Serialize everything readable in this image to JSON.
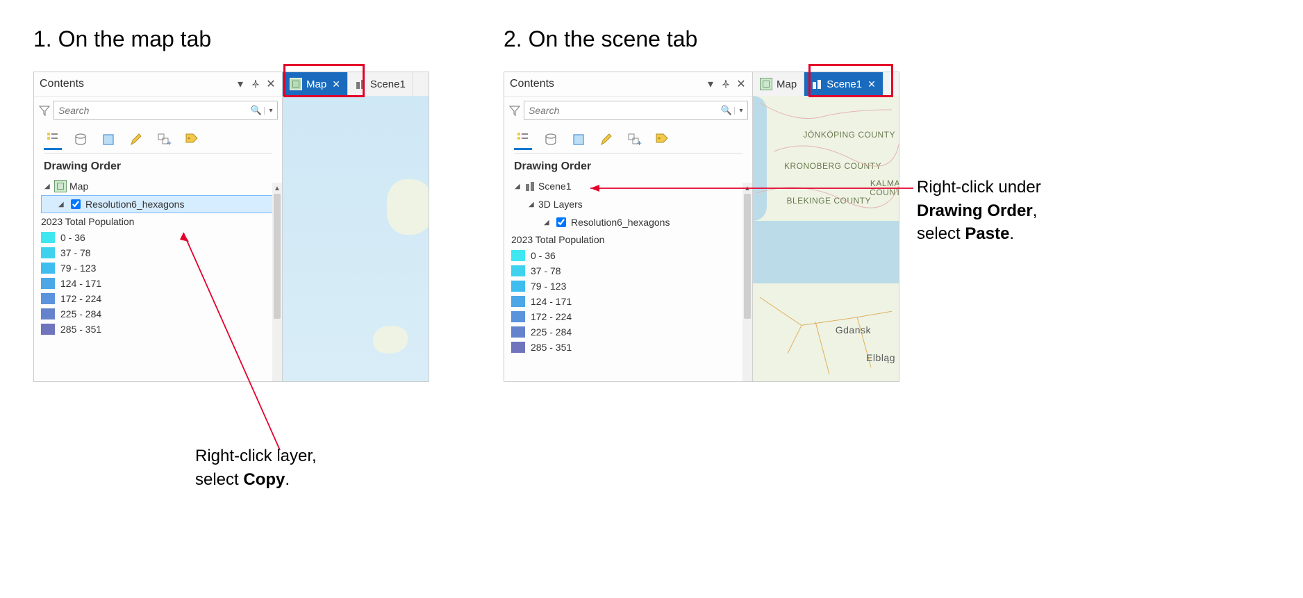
{
  "step1": {
    "title": "1. On the map tab",
    "annotation_prefix": "Right-click layer,",
    "annotation_action_pre": "select ",
    "annotation_action_bold": "Copy",
    "annotation_action_post": ".",
    "contents_title": "Contents",
    "search_placeholder": "Search",
    "section": "Drawing Order",
    "map_name": "Map",
    "layer_name": "Resolution6_hexagons",
    "legend_title": "2023 Total Population",
    "legend": [
      {
        "color": "#3fe7f0",
        "label": "0 - 36"
      },
      {
        "color": "#3fd2ef",
        "label": "37 - 78"
      },
      {
        "color": "#3fbdee",
        "label": "79 - 123"
      },
      {
        "color": "#4da6e6",
        "label": "124 - 171"
      },
      {
        "color": "#5b93dc",
        "label": "172 - 224"
      },
      {
        "color": "#6582cc",
        "label": "225 - 284"
      },
      {
        "color": "#6f74bd",
        "label": "285 - 351"
      }
    ],
    "tabs": {
      "map": "Map",
      "scene": "Scene1"
    }
  },
  "step2": {
    "title": "2. On the scene tab",
    "annotation_line1": "Right-click under",
    "annotation_line2_bold": "Drawing Order",
    "annotation_line2_post": ",",
    "annotation_line3_pre": "select ",
    "annotation_line3_bold": "Paste",
    "annotation_line3_post": ".",
    "contents_title": "Contents",
    "search_placeholder": "Search",
    "section": "Drawing Order",
    "scene_name": "Scene1",
    "group_name": "3D Layers",
    "layer_name": "Resolution6_hexagons",
    "legend_title": "2023 Total Population",
    "legend": [
      {
        "color": "#3fe7f0",
        "label": "0 - 36"
      },
      {
        "color": "#3fd2ef",
        "label": "37 - 78"
      },
      {
        "color": "#3fbdee",
        "label": "79 - 123"
      },
      {
        "color": "#4da6e6",
        "label": "124 - 171"
      },
      {
        "color": "#5b93dc",
        "label": "172 - 224"
      },
      {
        "color": "#6582cc",
        "label": "225 - 284"
      },
      {
        "color": "#6f74bd",
        "label": "285 - 351"
      }
    ],
    "tabs": {
      "map": "Map",
      "scene": "Scene1"
    },
    "map_labels": {
      "jkp": "JÖNKÖPING\nCOUNTY",
      "kro": "KRONOBERG\nCOUNTY",
      "kal": "KALMAR\nCOUNTY",
      "ble": "BLEKINGE\nCOUNTY",
      "gda": "Gdansk",
      "elb": "Elbląg"
    }
  }
}
